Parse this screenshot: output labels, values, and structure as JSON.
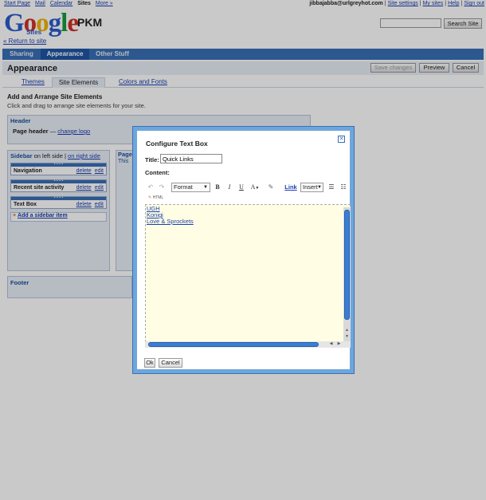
{
  "topnav": {
    "links": [
      "Start Page",
      "Mail",
      "Calendar"
    ],
    "current": "Sites",
    "more": "More »",
    "user": "jibbajabba@urlgreyhot.com",
    "right_links": [
      "Site settings",
      "My sites",
      "Help",
      "Sign out"
    ]
  },
  "logo": {
    "brand": "Google",
    "sub": "Sites"
  },
  "site_name": "PKM",
  "return_link": "« Return to site",
  "search": {
    "button": "Search Site",
    "value": ""
  },
  "tabs": [
    "Sharing",
    "Appearance",
    "Other Stuff"
  ],
  "page_title": "Appearance",
  "actions": {
    "save": "Save changes",
    "preview": "Preview",
    "cancel": "Cancel"
  },
  "subtabs": [
    "Themes",
    "Site Elements",
    "Colors and Fonts"
  ],
  "arrange": {
    "title": "Add and Arrange Site Elements",
    "subtitle": "Click and drag to arrange site elements for your site."
  },
  "header_panel": {
    "title": "Header",
    "row_label": "Page header",
    "row_dash": "—",
    "change_logo": "change logo"
  },
  "sidebar_panel": {
    "title": "Sidebar",
    "side_text": "on left side",
    "switch_side": "on right side",
    "widgets": [
      {
        "name": "Navigation",
        "delete": "delete",
        "edit": "edit"
      },
      {
        "name": "Recent site activity",
        "delete": "delete",
        "edit": "edit"
      },
      {
        "name": "Text Box",
        "delete": "delete",
        "edit": "edit"
      }
    ],
    "add_item": "Add a sidebar item"
  },
  "page_panel": {
    "title": "Page",
    "text": "This"
  },
  "footer_panel": {
    "title": "Footer"
  },
  "dialog": {
    "title": "Configure Text Box",
    "title_label": "Title:",
    "title_value": "Quick Links",
    "content_label": "Content:",
    "toolbar": {
      "format": "Format",
      "bold": "B",
      "italic": "I",
      "underline": "U",
      "text_color": "A",
      "link": "Link",
      "insert": "Insert"
    },
    "html_label": "HTML",
    "content_links": [
      "UGH",
      "Konigi",
      "Love & Sprockets"
    ],
    "ok": "Ok",
    "cancel": "Cancel"
  }
}
